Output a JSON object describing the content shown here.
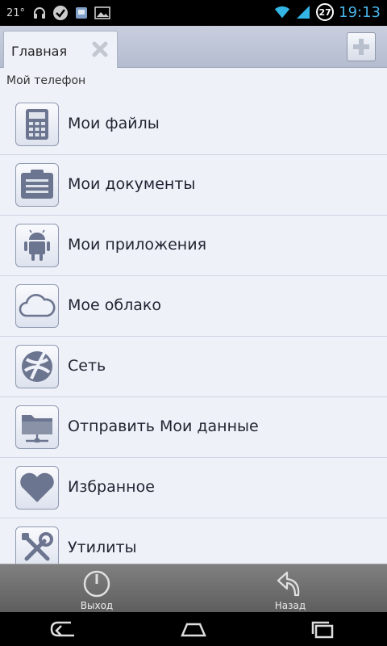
{
  "status_bar": {
    "temperature": "21°",
    "notification_icons": [
      "headphones-icon",
      "checkmark-bubble-icon",
      "usb-debug-icon",
      "image-icon"
    ],
    "badge": "27",
    "time": "19:13"
  },
  "tabs": {
    "active_label": "Главная"
  },
  "section": {
    "title": "Мой телефон"
  },
  "items": [
    {
      "label": "Мои файлы",
      "icon": "calculator-icon"
    },
    {
      "label": "Мои документы",
      "icon": "documents-icon"
    },
    {
      "label": "Мои приложения",
      "icon": "android-icon"
    },
    {
      "label": "Мое облако",
      "icon": "cloud-icon"
    },
    {
      "label": "Сеть",
      "icon": "network-icon"
    },
    {
      "label": "Отправить Мои данные",
      "icon": "shared-folder-icon"
    },
    {
      "label": "Избранное",
      "icon": "heart-icon"
    },
    {
      "label": "Утилиты",
      "icon": "tools-icon"
    }
  ],
  "actions": {
    "exit_label": "Выход",
    "back_label": "Назад"
  },
  "colors": {
    "time": "#4ab3e8",
    "content_bg": "#eef1f8",
    "icon_fill": "#6c7590"
  }
}
